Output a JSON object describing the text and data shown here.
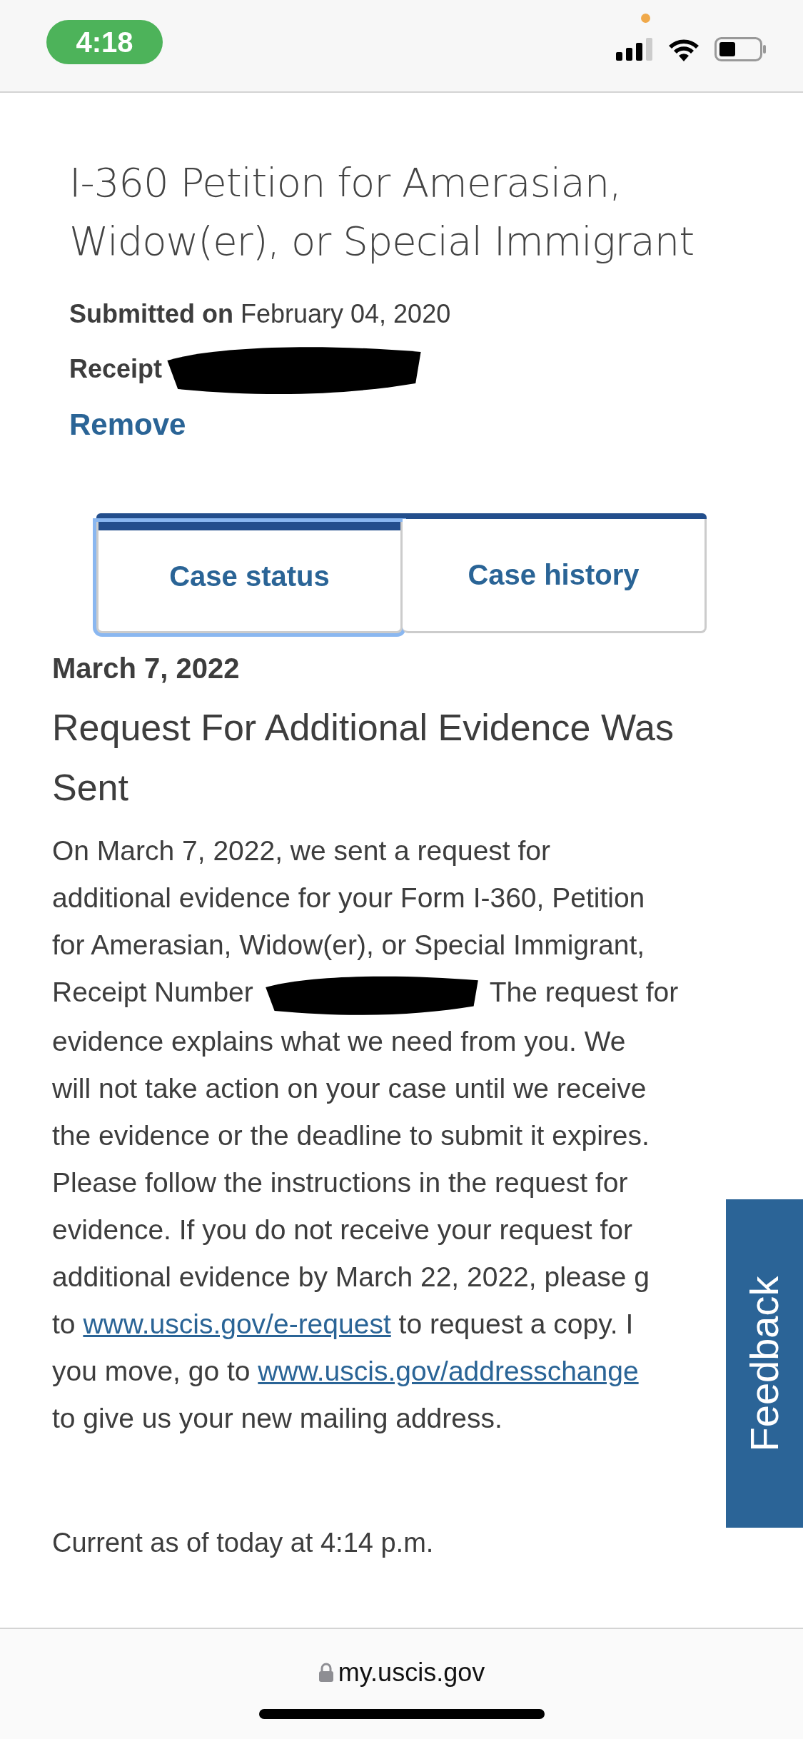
{
  "status_bar": {
    "time": "4:18"
  },
  "case": {
    "title": "I-360 Petition for Amerasian, Widow(er), or Special Immigrant",
    "submitted_label": "Submitted on",
    "submitted_date": "February 04, 2020",
    "receipt_label": "Receipt",
    "remove": "Remove"
  },
  "tabs": [
    {
      "label": "Case status",
      "selected": true
    },
    {
      "label": "Case history",
      "selected": false
    }
  ],
  "status": {
    "date": "March 7, 2022",
    "heading": "Request For Additional Evidence Was Sent",
    "lines": [
      [
        {
          "kind": "text",
          "text": "On March 7, 2022, we sent a request for"
        }
      ],
      [
        {
          "kind": "text",
          "text": "additional evidence for your Form I-360, Petition"
        }
      ],
      [
        {
          "kind": "text",
          "text": "for Amerasian, Widow(er), or Special Immigrant,"
        }
      ],
      [
        {
          "kind": "text",
          "text": "Receipt Number "
        },
        {
          "kind": "redaction"
        },
        {
          "kind": "text",
          "text": " The request for"
        }
      ],
      [
        {
          "kind": "text",
          "text": "evidence explains what we need from you. We"
        }
      ],
      [
        {
          "kind": "text",
          "text": "will not take action on your case until we receive"
        }
      ],
      [
        {
          "kind": "text",
          "text": "the evidence or the deadline to submit it expires."
        }
      ],
      [
        {
          "kind": "text",
          "text": "Please follow the instructions in the request for"
        }
      ],
      [
        {
          "kind": "text",
          "text": "evidence. If you do not receive your request for"
        }
      ],
      [
        {
          "kind": "text",
          "text": "additional evidence by March 22, 2022, please g"
        }
      ],
      [
        {
          "kind": "text",
          "text": "to "
        },
        {
          "kind": "link",
          "text": "www.uscis.gov/e-request"
        },
        {
          "kind": "text",
          "text": " to request a copy. I"
        }
      ],
      [
        {
          "kind": "text",
          "text": "you move, go to "
        },
        {
          "kind": "link",
          "text": "www.uscis.gov/addresschange"
        }
      ],
      [
        {
          "kind": "text",
          "text": "to give us your new mailing address."
        }
      ]
    ],
    "current": "Current as of today at 4:14 p.m."
  },
  "feedback": "Feedback",
  "address_bar": {
    "url": "my.uscis.gov"
  }
}
